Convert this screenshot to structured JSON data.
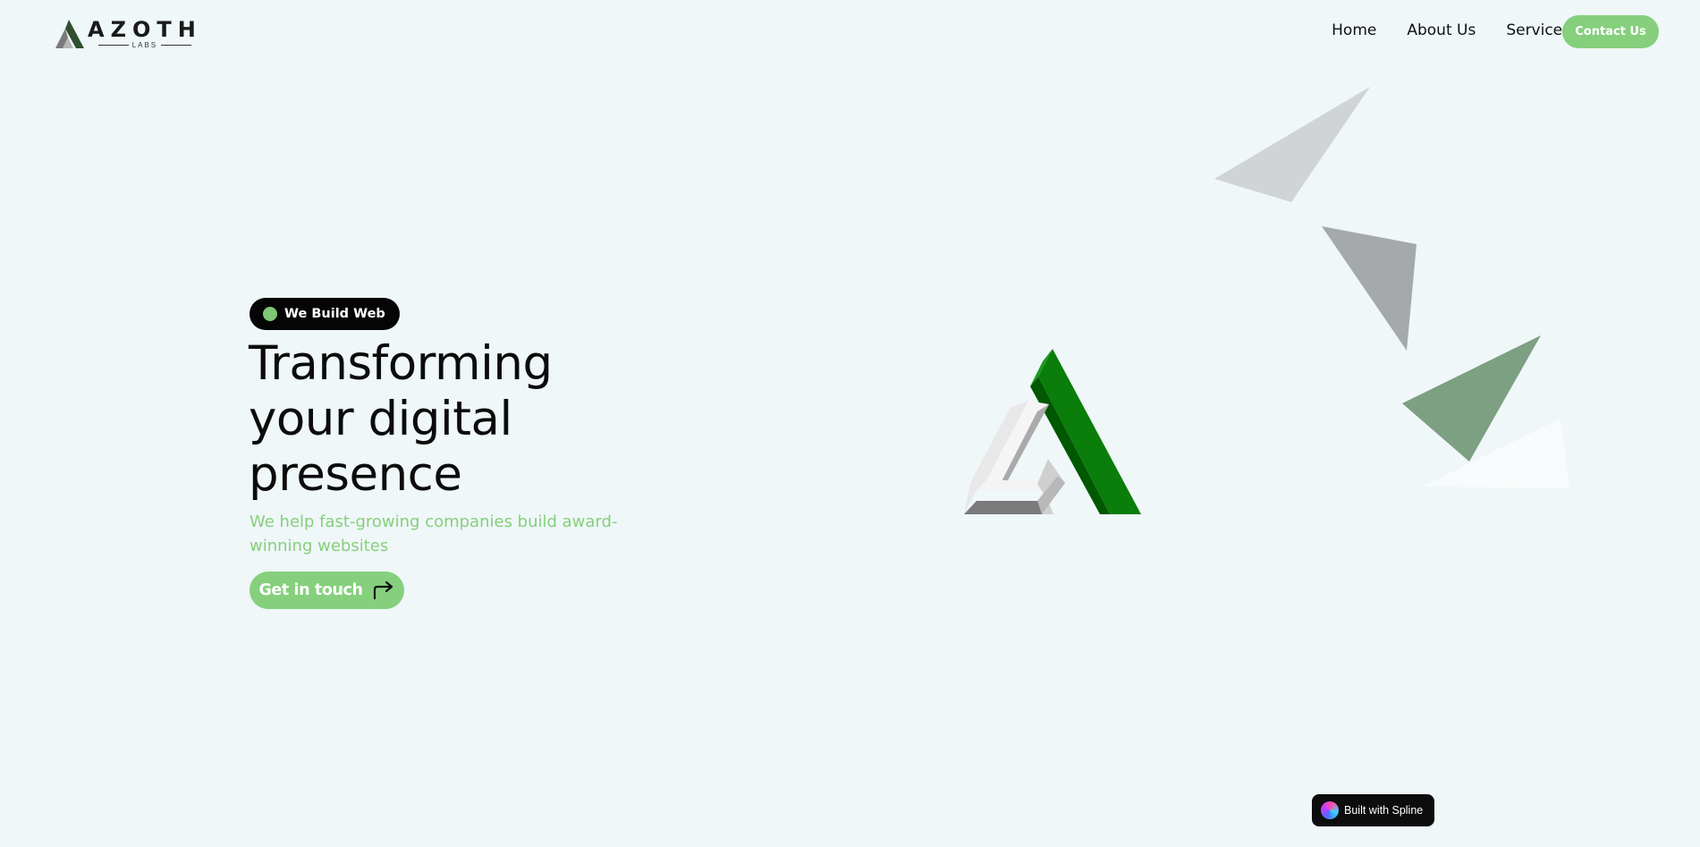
{
  "brand": {
    "name": "AZOTH",
    "sub": "LABS"
  },
  "nav": {
    "items": [
      {
        "label": "Home"
      },
      {
        "label": "About Us"
      },
      {
        "label": "Services"
      }
    ],
    "contact_label": "Contact Us"
  },
  "hero": {
    "badge": "We Build Web",
    "headline_lines": [
      "Transforming",
      "your digital",
      "presence"
    ],
    "subhead": "We help fast-growing companies build award-winning websites",
    "cta_label": "Get in touch"
  },
  "footer_badge": {
    "label": "Built with Spline"
  },
  "colors": {
    "background": "#eff7f8",
    "accent_green": "#86cf7d",
    "badge_black": "#050505",
    "logo_green": "#0f8a0f",
    "logo_dark_green": "#005a00"
  },
  "icons": {
    "badge_dot": "green-dot-icon",
    "cta_arrow": "turn-right-arrow-icon",
    "spline": "spline-logo-icon"
  }
}
